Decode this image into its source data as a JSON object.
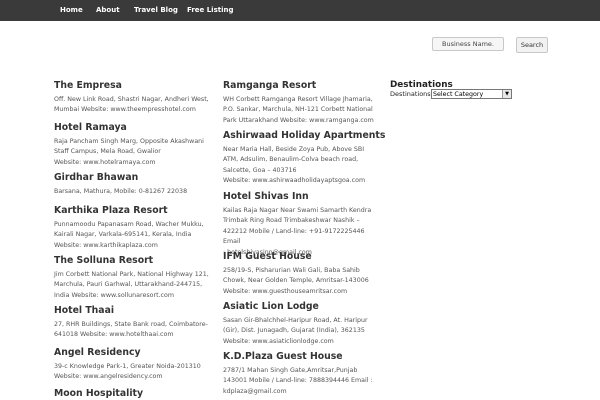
{
  "nav": {
    "items": [
      {
        "label": "Home"
      },
      {
        "label": "About"
      },
      {
        "label": "Travel Blog"
      },
      {
        "label": "Free Listing"
      }
    ]
  },
  "search": {
    "value": "Business Name.",
    "button_label": "Search"
  },
  "listings_left": [
    {
      "title": "The Empresa",
      "desc": "Off. New Link Road, Shastri Nagar, Andheri West,\nMumbai Website: www.theempresshotel.com"
    },
    {
      "title": "Hotel Ramaya",
      "desc": "Raja Pancham Singh Marg, Opposite Akashwani\nStaff Campus, Mela Road, Gwalior\nWebsite: www.hotelramaya.com"
    },
    {
      "title": "Girdhar Bhawan",
      "desc": "Barsana, Mathura, Mobile: 0-81267 22038"
    },
    {
      "title": "Karthika Plaza Resort",
      "desc": "Punnamoodu Papanasam Road, Wacher Mukku,\nKairali Nagar, Varkala-695141, Kerala, India\nWebsite: www.karthikaplaza.com"
    },
    {
      "title": "The Solluna Resort",
      "desc": "Jim Corbett National Park, National Highway 121,\nMarchula, Pauri Garhwal, Uttarakhand-244715,\nIndia Website: www.sollunaresort.com"
    },
    {
      "title": "Hotel Thaai",
      "desc": "27, RHR Buildings, State Bank road, Coimbatore-\n641018 Website: www.hotelthaai.com"
    },
    {
      "title": "Angel Residency",
      "desc": "39-c Knowledge Park-1, Greater Noida-201310\nWebsite: www.angelresidency.com"
    },
    {
      "title": "Moon Hospitality",
      "desc": ""
    }
  ],
  "listings_right": [
    {
      "title": "Ramganga Resort",
      "desc": "WH Corbett Ramganga Resort Village Jhamaria,\nP.O. Sankar, Marchula, NH-121 Corbett National\nPark Uttarakhand Website: www.ramganga.com"
    },
    {
      "title": "Ashirwaad Holiday Apartments",
      "desc": "Near Maria Hall, Beside Zoya Pub, Above SBI\nATM, Adsulim, Benaulim-Colva beach road,\nSalcette, Goa – 403716\nWebsite: www.ashirwaadholidayaptsgoa.com"
    },
    {
      "title": "Hotel Shivas Inn",
      "desc": "Kailas Raja Nagar Near Swami Samarth Kendra\nTrimbak Ring Road Trimbakeshwar Nashik –\n422212 Mobile / Land-line: +91-9172225446 Email\n: hotelshivasinn@gmail.com"
    },
    {
      "title": "IFM Guest House",
      "desc": "258/19-S, Pisharurian Wali Gali, Baba Sahib\nChowk, Near Golden Temple, Amritsar-143006\nWebsite: www.guesthouseamritsar.com"
    },
    {
      "title": "Asiatic Lion Lodge",
      "desc": "Sasan Gir-Bhalchhel-Haripur Road, At. Haripur\n(Gir), Dist. Junagadh, Gujarat (India), 362135\nWebsite: www.asiaticlionlodge.com"
    },
    {
      "title": "K.D.Plaza Guest House",
      "desc": "2787/1 Mahan Singh Gate,Amritsar,Punjab\n143001 Mobile / Land-line: 7888394446 Email :\nkdplaza@gmail.com"
    }
  ],
  "sidebar": {
    "title": "Destinations",
    "label": "Destinations",
    "select_value": "Select Category"
  }
}
